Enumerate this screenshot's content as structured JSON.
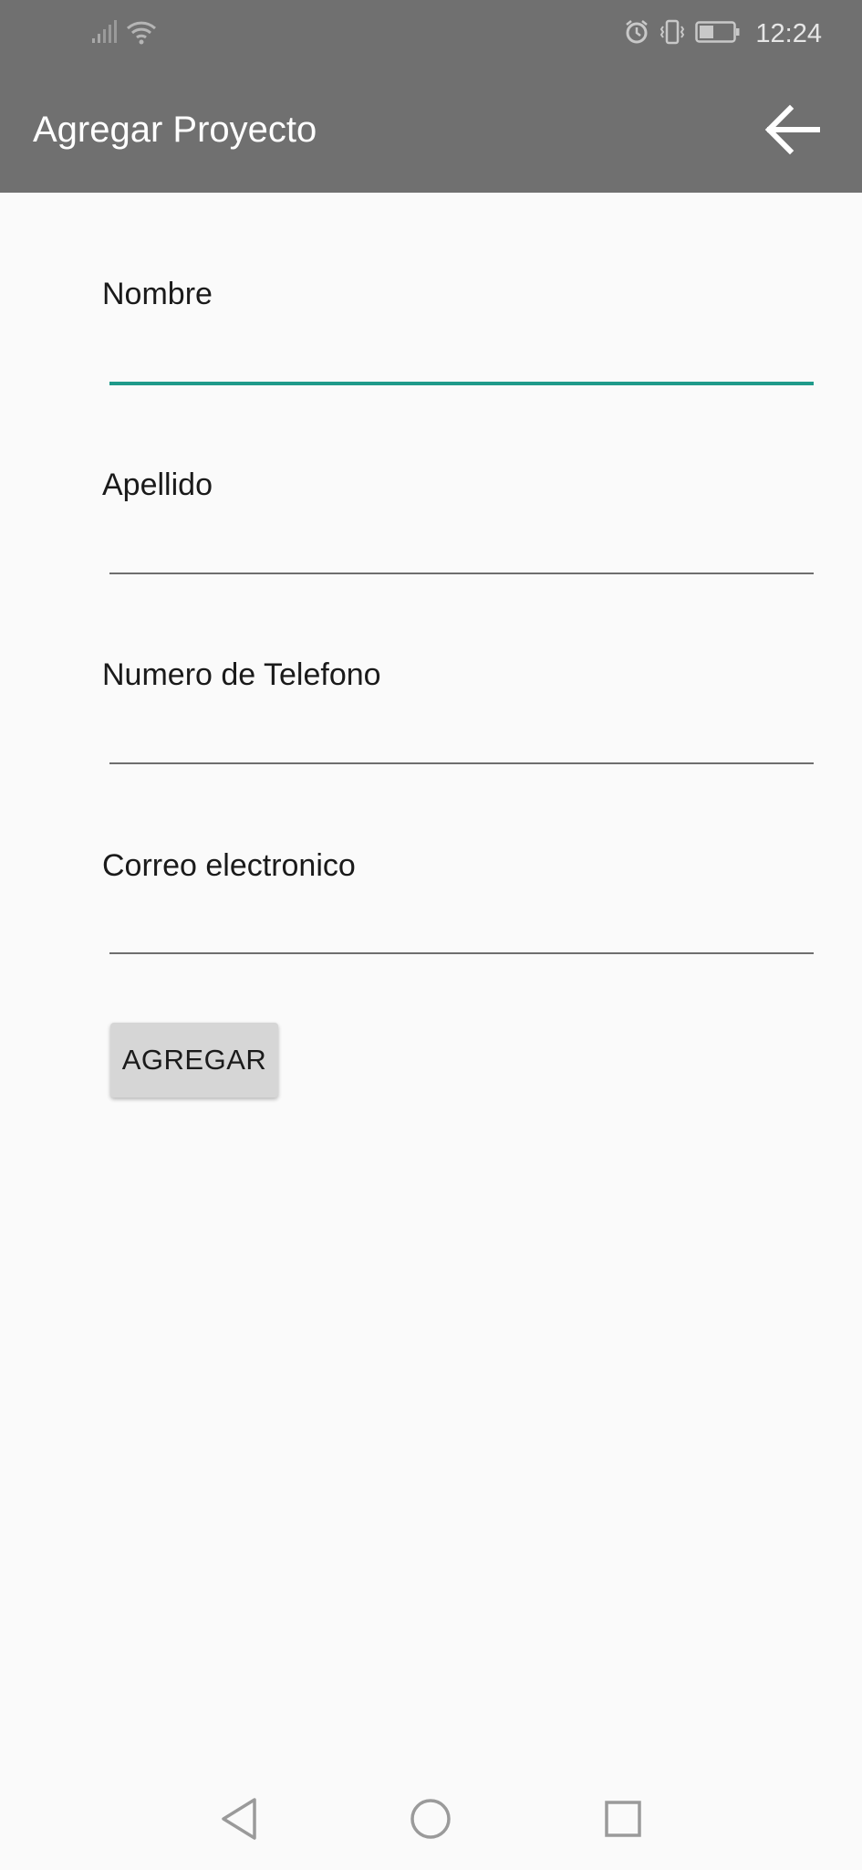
{
  "status_bar": {
    "time": "12:24",
    "icons": [
      "signal-icon",
      "wifi-icon",
      "alarm-icon",
      "vibrate-icon",
      "battery-icon"
    ]
  },
  "app_bar": {
    "title": "Agregar Proyecto",
    "back_icon": "arrow-back-icon"
  },
  "form": {
    "fields": [
      {
        "label": "Nombre",
        "value": "",
        "focused": true
      },
      {
        "label": "Apellido",
        "value": ""
      },
      {
        "label": "Numero de Telefono",
        "value": ""
      },
      {
        "label": "Correo electronico",
        "value": ""
      }
    ],
    "submit_label": "AGREGAR"
  },
  "nav_bar": {
    "icons": [
      "back-triangle-icon",
      "home-circle-icon",
      "recents-square-icon"
    ]
  },
  "colors": {
    "toolbar": "#707070",
    "accent": "#1f9a8a",
    "background": "#fafafa",
    "button": "#d6d6d6"
  }
}
